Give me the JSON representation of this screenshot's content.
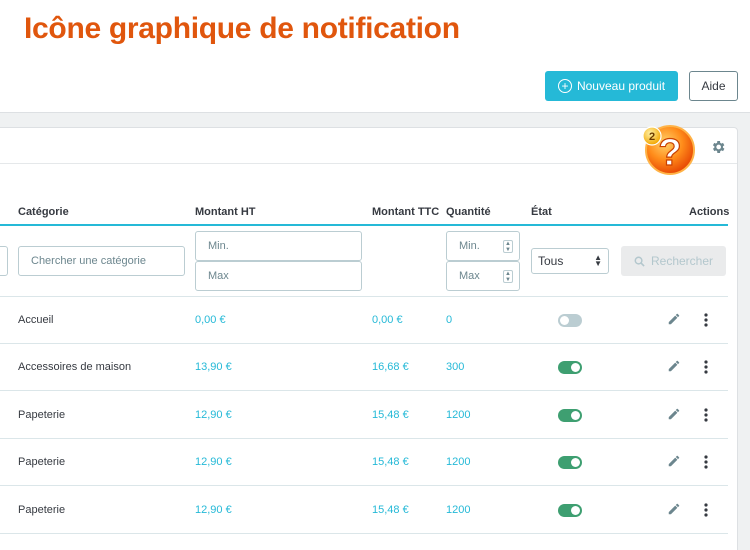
{
  "headline": "Icône graphique de notification",
  "toolbar": {
    "new_product_label": "Nouveau produit",
    "help_label": "Aide"
  },
  "notification": {
    "count": "2",
    "icon": "help-bubble-icon",
    "color": "#ff9a1a"
  },
  "columns": {
    "category": "Catégorie",
    "amount_ht": "Montant HT",
    "amount_ttc": "Montant TTC",
    "quantity": "Quantité",
    "state": "État",
    "actions": "Actions"
  },
  "filters": {
    "category_placeholder": "Chercher une catégorie",
    "ht_min_placeholder": "Min.",
    "ht_max_placeholder": "Max",
    "qty_min_placeholder": "Min.",
    "qty_max_placeholder": "Max",
    "state_selected": "Tous",
    "search_label": "Rechercher"
  },
  "rows": [
    {
      "category": "Accueil",
      "ht": "0,00 €",
      "ttc": "0,00 €",
      "qty": "0",
      "active": false
    },
    {
      "category": "Accessoires de maison",
      "ht": "13,90 €",
      "ttc": "16,68 €",
      "qty": "300",
      "active": true
    },
    {
      "category": "Papeterie",
      "ht": "12,90 €",
      "ttc": "15,48 €",
      "qty": "1200",
      "active": true
    },
    {
      "category": "Papeterie",
      "ht": "12,90 €",
      "ttc": "15,48 €",
      "qty": "1200",
      "active": true
    },
    {
      "category": "Papeterie",
      "ht": "12,90 €",
      "ttc": "15,48 €",
      "qty": "1200",
      "active": true
    }
  ],
  "colors": {
    "accent": "#25b9d7",
    "headline": "#e0560d",
    "toggle_on": "#3e9f71",
    "toggle_off": "#bbcdd2"
  }
}
